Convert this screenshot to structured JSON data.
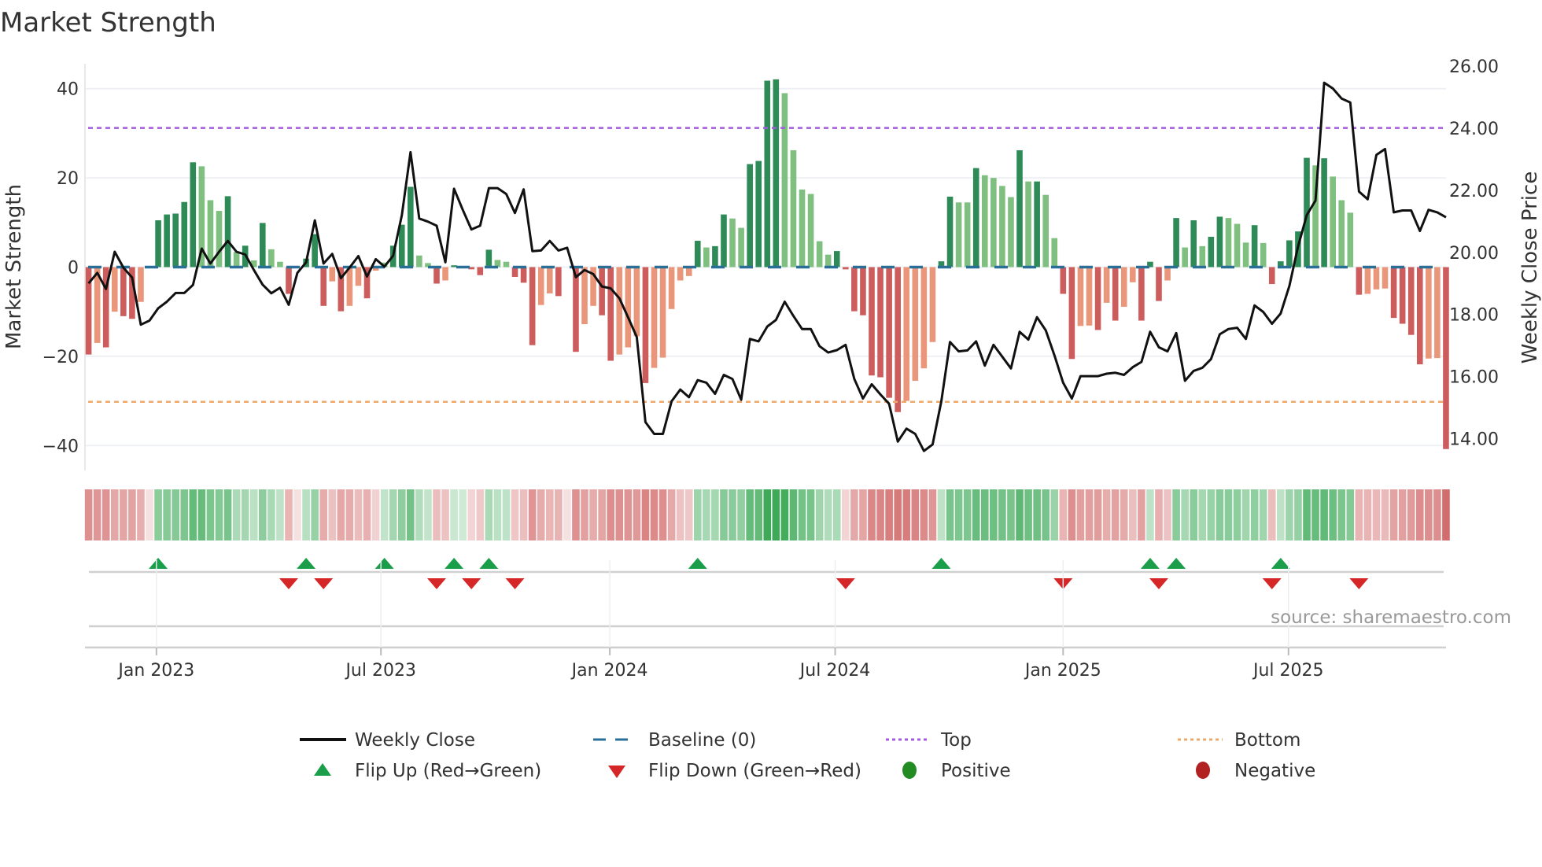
{
  "title": "Market Strength",
  "source": "source: sharemaestro.com",
  "colors": {
    "strong_up": "#2e8b57",
    "weak_up": "#7fbf7f",
    "strong_down": "#cd5c5c",
    "weak_down": "#e9967a",
    "close": "#111111",
    "baseline": "#2a6f97",
    "top": "#a35be0",
    "bottom": "#f0a868",
    "flip_up": "#1a9e4a",
    "flip_down": "#d62728",
    "positive": "#228b22",
    "negative": "#b22222"
  },
  "chart_data": {
    "type": "bar",
    "title": "Market Strength",
    "ylabel": "Market Strength",
    "y2label": "Weekly Close Price",
    "ylim": [
      -45.6,
      45.6
    ],
    "y2lim": [
      12.97,
      26.08
    ],
    "yticks": [
      "40",
      "20",
      "0",
      "−20",
      "−40"
    ],
    "ytick_values": [
      40,
      20,
      0,
      -20,
      -40
    ],
    "y2ticks": [
      "26.00",
      "24.00",
      "22.00",
      "20.00",
      "18.00",
      "16.00",
      "14.00"
    ],
    "y2tick_values": [
      26,
      24,
      22,
      20,
      18,
      16,
      14
    ],
    "xticks": [
      {
        "label": "Jan 2023",
        "week": 7.8
      },
      {
        "label": "Jul 2023",
        "week": 33.6
      },
      {
        "label": "Jan 2024",
        "week": 59.9
      },
      {
        "label": "Jul 2024",
        "week": 85.8
      },
      {
        "label": "Jan 2025",
        "week": 112
      },
      {
        "label": "Jul 2025",
        "week": 137.9
      }
    ],
    "top_level": 31.2,
    "bottom_level": -30.2,
    "baseline": 0,
    "strength": [
      -19.6,
      -17,
      -18,
      -10,
      -11,
      -11.6,
      -7.8,
      0,
      10.5,
      11.8,
      12,
      14.6,
      23.5,
      22.6,
      15,
      12.6,
      15.9,
      3.4,
      4.8,
      1.5,
      9.9,
      4,
      1.2,
      -6,
      0,
      1.9,
      7.4,
      -8.7,
      -3.2,
      -9.9,
      -8.7,
      -4.2,
      -7,
      -0.8,
      1,
      4.8,
      9.5,
      18,
      2.6,
      0.9,
      -3.7,
      -3,
      0.4,
      0.2,
      -0.5,
      -1.8,
      3.9,
      1.6,
      1.2,
      -2.2,
      -3.5,
      -17.5,
      -8.5,
      -5.9,
      -6.5,
      0,
      -19,
      -12.8,
      -8.7,
      -10.8,
      -21,
      -19.6,
      -18,
      -15.5,
      -26,
      -22.6,
      -20.3,
      -9.4,
      -3,
      -2,
      5.9,
      4.4,
      4.7,
      11.8,
      10.9,
      8.8,
      23.1,
      23.8,
      41.8,
      42.1,
      39,
      26.2,
      17.4,
      16.4,
      5.8,
      2.8,
      3.6,
      -0.5,
      -9.9,
      -10.8,
      -24.3,
      -24.7,
      -29.3,
      -32.5,
      -30,
      -25.5,
      -22.7,
      -16.8,
      1.3,
      15.8,
      14.5,
      14.5,
      22.2,
      20.6,
      20,
      18.2,
      15.7,
      26.2,
      19.2,
      19.2,
      16.2,
      6.5,
      -6,
      -20.6,
      -13.2,
      -13.1,
      -14.1,
      -8,
      -12,
      -8.9,
      -3.4,
      -12,
      1.2,
      -7.6,
      -3,
      11,
      4.4,
      10.5,
      4.7,
      6.8,
      11.3,
      11,
      9.7,
      5.5,
      9.4,
      5.4,
      -3.8,
      1.3,
      6,
      8,
      24.5,
      22.8,
      24.4,
      20.3,
      15,
      12.2,
      -6.2,
      -6,
      -5,
      -4.8,
      -11.4,
      -12.7,
      -15.2,
      -21.8,
      -20.5,
      -20.4,
      -40.8
    ],
    "shade": "RSRSRRSZDDDDDLLLDLDLDLLRZDDRSRSSRSLDDDLLRSDLRRDLLRRRSSRZRSSRRSSSRSSSSSDLDDLLDDDDLLLLLLDRRRRRRRSSSSDDLLDLLLLDLDLLRRSSRSRSSRDRSDLDLDDLLLDLRDDDDLDLLLRSSSRRRRSSR",
    "close": [
      19.0,
      19.34,
      18.82,
      20.02,
      19.51,
      19.19,
      17.67,
      17.8,
      18.2,
      18.41,
      18.69,
      18.69,
      18.95,
      20.12,
      19.64,
      20.02,
      20.37,
      20.02,
      19.93,
      19.43,
      18.96,
      18.68,
      18.86,
      18.31,
      19.34,
      19.68,
      21.03,
      19.64,
      19.95,
      19.17,
      19.51,
      19.88,
      19.22,
      19.78,
      19.54,
      19.89,
      21.2,
      23.23,
      21.09,
      20.99,
      20.86,
      19.68,
      22.05,
      21.37,
      20.74,
      20.86,
      22.07,
      22.07,
      21.88,
      21.27,
      22.03,
      20.04,
      20.06,
      20.37,
      20.06,
      20.15,
      19.2,
      19.43,
      19.3,
      18.9,
      18.84,
      18.52,
      17.91,
      17.27,
      14.53,
      14.15,
      14.15,
      15.2,
      15.58,
      15.33,
      15.88,
      15.8,
      15.44,
      16.05,
      15.92,
      15.25,
      17.21,
      17.13,
      17.61,
      17.82,
      18.41,
      17.95,
      17.53,
      17.53,
      16.98,
      16.77,
      16.85,
      17.02,
      15.92,
      15.29,
      15.75,
      15.42,
      15.12,
      13.9,
      14.32,
      14.15,
      13.6,
      13.81,
      15.2,
      17.11,
      16.81,
      16.84,
      17.13,
      16.35,
      17.02,
      16.64,
      16.26,
      17.44,
      17.19,
      17.91,
      17.49,
      16.68,
      15.8,
      15.29,
      16.01,
      16.01,
      16.01,
      16.09,
      16.12,
      16.05,
      16.3,
      16.47,
      17.44,
      16.94,
      16.81,
      17.4,
      15.86,
      16.18,
      16.28,
      16.56,
      17.36,
      17.53,
      17.57,
      17.21,
      18.29,
      18.08,
      17.7,
      18.03,
      18.92,
      20.19,
      21.2,
      21.67,
      25.47,
      25.28,
      24.96,
      24.83,
      21.96,
      21.71,
      23.14,
      23.33,
      21.29,
      21.35,
      21.35,
      20.69,
      21.37,
      21.29,
      21.13
    ],
    "flip_up_weeks": [
      8,
      25,
      34,
      42,
      46,
      70,
      98,
      122,
      125,
      137
    ],
    "flip_down_weeks": [
      23,
      27,
      40,
      44,
      49,
      87,
      112,
      123,
      136,
      146
    ],
    "legend": {
      "weekly_close": "Weekly Close",
      "baseline": "Baseline (0)",
      "top": "Top",
      "bottom": "Bottom",
      "flip_up": "Flip Up (Red→Green)",
      "flip_down": "Flip Down (Green→Red)",
      "positive": "Positive",
      "negative": "Negative"
    }
  }
}
